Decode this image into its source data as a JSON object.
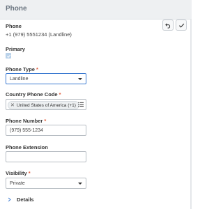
{
  "header": {
    "title": "Phone"
  },
  "phone": {
    "label": "Phone",
    "value": "+1 (979) 5551234 (Landline)"
  },
  "actions": {
    "undo_icon": "undo-icon",
    "confirm_icon": "check-icon"
  },
  "primary": {
    "label": "Primary",
    "checked": true
  },
  "phone_type": {
    "label": "Phone Type",
    "required": "*",
    "value": "Landline"
  },
  "country_code": {
    "label": "Country Phone Code",
    "required": "*",
    "selected": "United States of America (+1)"
  },
  "phone_number": {
    "label": "Phone Number",
    "required": "*",
    "value": "(979) 555-1234"
  },
  "phone_extension": {
    "label": "Phone Extension",
    "value": ""
  },
  "visibility": {
    "label": "Visibility",
    "required": "*",
    "value": "Private"
  },
  "details": {
    "label": "Details"
  },
  "colors": {
    "required": "#e05a3a",
    "focus_border": "#3d7bd1",
    "header_bg": "#eef0f2"
  }
}
